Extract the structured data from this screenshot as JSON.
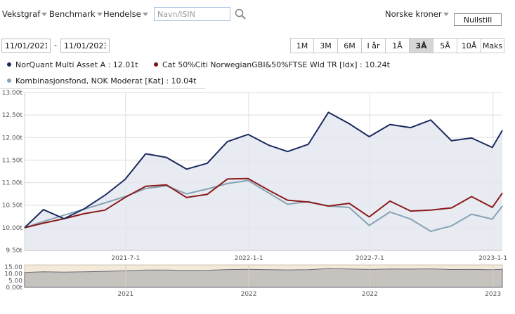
{
  "toolbar": {
    "graph_type_label": "Vekstgraf",
    "benchmark_label": "Benchmark",
    "event_label": "Hendelse",
    "search_placeholder": "Navn/ISIN",
    "currency_label": "Norske kroner",
    "reset_label": "Nullstill"
  },
  "date_range": {
    "from": "11/01/2021",
    "separator": "-",
    "to": "11/01/2023"
  },
  "periods": [
    {
      "label": "1M",
      "active": false
    },
    {
      "label": "3M",
      "active": false
    },
    {
      "label": "6M",
      "active": false
    },
    {
      "label": "I år",
      "active": false
    },
    {
      "label": "1Å",
      "active": false
    },
    {
      "label": "3Å",
      "active": true
    },
    {
      "label": "5Å",
      "active": false
    },
    {
      "label": "10Å",
      "active": false
    },
    {
      "label": "Maks",
      "active": false
    }
  ],
  "legend": [
    {
      "text": "NorQuant Multi Asset A : 12.01t",
      "color": "#1a2a5e"
    },
    {
      "text": "Cat 50%Citi NorwegianGBI&50%FTSE Wld TR [Idx] : 10.24t",
      "color": "#7a1010"
    },
    {
      "text": "Kombinasjonsfond, NOK Moderat [Kat] : 10.04t",
      "color": "#86a4b4"
    }
  ],
  "colors": {
    "series1": "#1a2a5e",
    "series2": "#8b1a1a",
    "series3": "#86a4b4",
    "area_fill": "#e3e6f0",
    "grid": "#dedede",
    "nav_fill": "#f3ead9"
  },
  "chart_data": {
    "type": "line",
    "x": [
      "2021-01-31",
      "2021-02-28",
      "2021-03-31",
      "2021-04-30",
      "2021-05-31",
      "2021-06-30",
      "2021-07-31",
      "2021-08-31",
      "2021-09-30",
      "2021-10-31",
      "2021-11-30",
      "2021-12-31",
      "2022-01-31",
      "2022-02-28",
      "2022-03-31",
      "2022-04-30",
      "2022-05-31",
      "2022-06-30",
      "2022-07-31",
      "2022-08-31",
      "2022-09-30",
      "2022-10-31",
      "2022-11-30",
      "2022-12-31",
      "2023-01-15"
    ],
    "series": [
      {
        "name": "NorQuant Multi Asset A",
        "values": [
          10.0,
          10.4,
          10.2,
          10.42,
          10.72,
          11.07,
          11.64,
          11.56,
          11.3,
          11.43,
          11.91,
          12.07,
          11.83,
          11.69,
          11.85,
          12.56,
          12.31,
          12.02,
          12.29,
          12.22,
          12.39,
          11.93,
          11.99,
          11.78,
          12.16
        ]
      },
      {
        "name": "Cat 50%Citi NorwegianGBI&50%FTSE Wld TR [Idx]",
        "values": [
          10.0,
          10.1,
          10.2,
          10.31,
          10.39,
          10.67,
          10.92,
          10.95,
          10.67,
          10.74,
          11.08,
          11.09,
          10.83,
          10.61,
          10.57,
          10.48,
          10.54,
          10.24,
          10.59,
          10.37,
          10.39,
          10.44,
          10.69,
          10.45,
          10.77
        ]
      },
      {
        "name": "Kombinasjonsfond, NOK Moderat [Kat]",
        "values": [
          10.0,
          10.14,
          10.28,
          10.41,
          10.55,
          10.69,
          10.87,
          10.93,
          10.75,
          10.86,
          10.98,
          11.05,
          10.77,
          10.52,
          10.58,
          10.48,
          10.45,
          10.05,
          10.35,
          10.19,
          9.92,
          10.04,
          10.3,
          10.19,
          10.48
        ]
      }
    ],
    "x_ticks": [
      {
        "date": "2021-07-01",
        "label": "2021-7-1"
      },
      {
        "date": "2022-01-01",
        "label": "2022-1-1"
      },
      {
        "date": "2022-07-01",
        "label": "2022-7-1"
      },
      {
        "date": "2023-01-01",
        "label": "2023-1-1"
      }
    ],
    "y_ticks": [
      9.5,
      10.0,
      10.5,
      11.0,
      11.5,
      12.0,
      12.5,
      13.0
    ],
    "y_tick_labels": [
      "9.50t",
      "10.00t",
      "10.50t",
      "11.00t",
      "11.50t",
      "12.00t",
      "12.50t",
      "13.00t"
    ],
    "ylim": [
      9.5,
      13.0
    ],
    "grid": true,
    "navigator": {
      "y_tick_labels": [
        "15.00",
        "10.00",
        "5.00",
        "0.00t"
      ],
      "ylim": [
        0,
        15
      ],
      "x_labels": [
        {
          "date": "2021-07-01",
          "label": "2021"
        },
        {
          "date": "2022-01-01",
          "label": "2022"
        },
        {
          "date": "2022-07-01",
          "label": "2022"
        },
        {
          "date": "2023-01-01",
          "label": "2023"
        }
      ]
    }
  }
}
